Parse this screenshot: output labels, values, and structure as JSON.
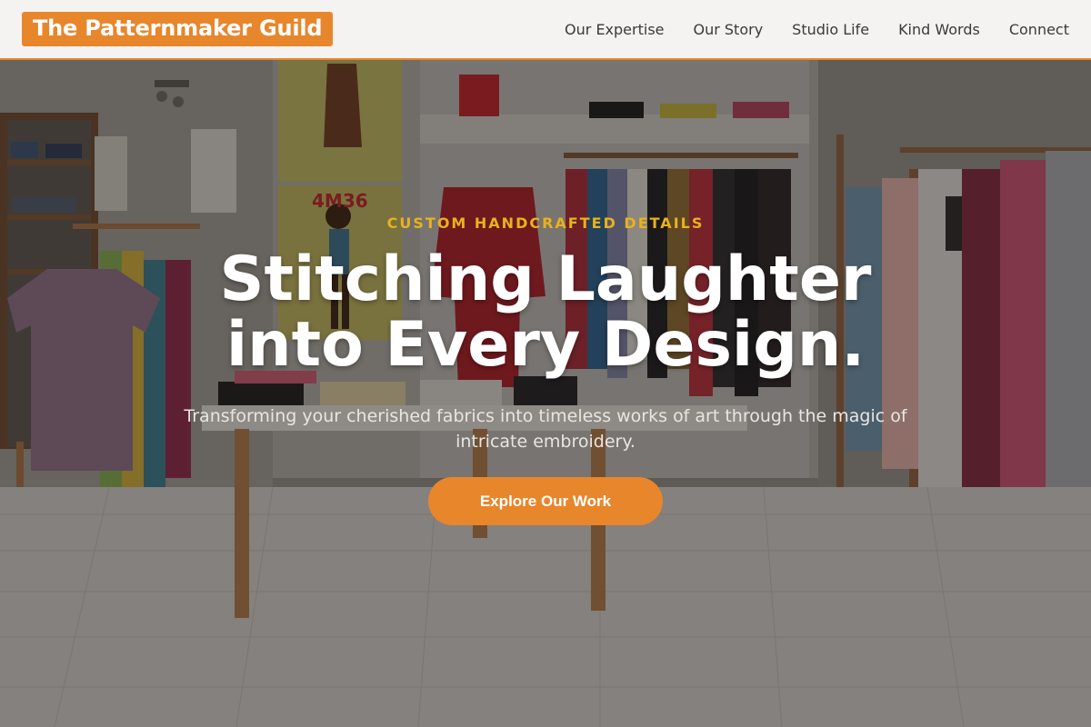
{
  "brand": {
    "name": "The Patternmaker Guild"
  },
  "nav": {
    "items": [
      {
        "label": "Our Expertise"
      },
      {
        "label": "Our Story"
      },
      {
        "label": "Studio Life"
      },
      {
        "label": "Kind Words"
      },
      {
        "label": "Connect"
      }
    ]
  },
  "hero": {
    "eyebrow": "CUSTOM HANDCRAFTED DETAILS",
    "headline_line1": "Stitching Laughter",
    "headline_line2": "into Every Design.",
    "subtext": "Transforming your cherished fabrics into timeless works of art through the magic of intricate embroidery.",
    "cta_label": "Explore Our Work",
    "background_description": "clothing boutique interior with garment racks, folded stacks and a white tiled floor",
    "store_sign": "4M36"
  },
  "colors": {
    "accent": "#e8862c",
    "eyebrow": "#e8b21c",
    "header_bg": "#f4f3f1"
  }
}
